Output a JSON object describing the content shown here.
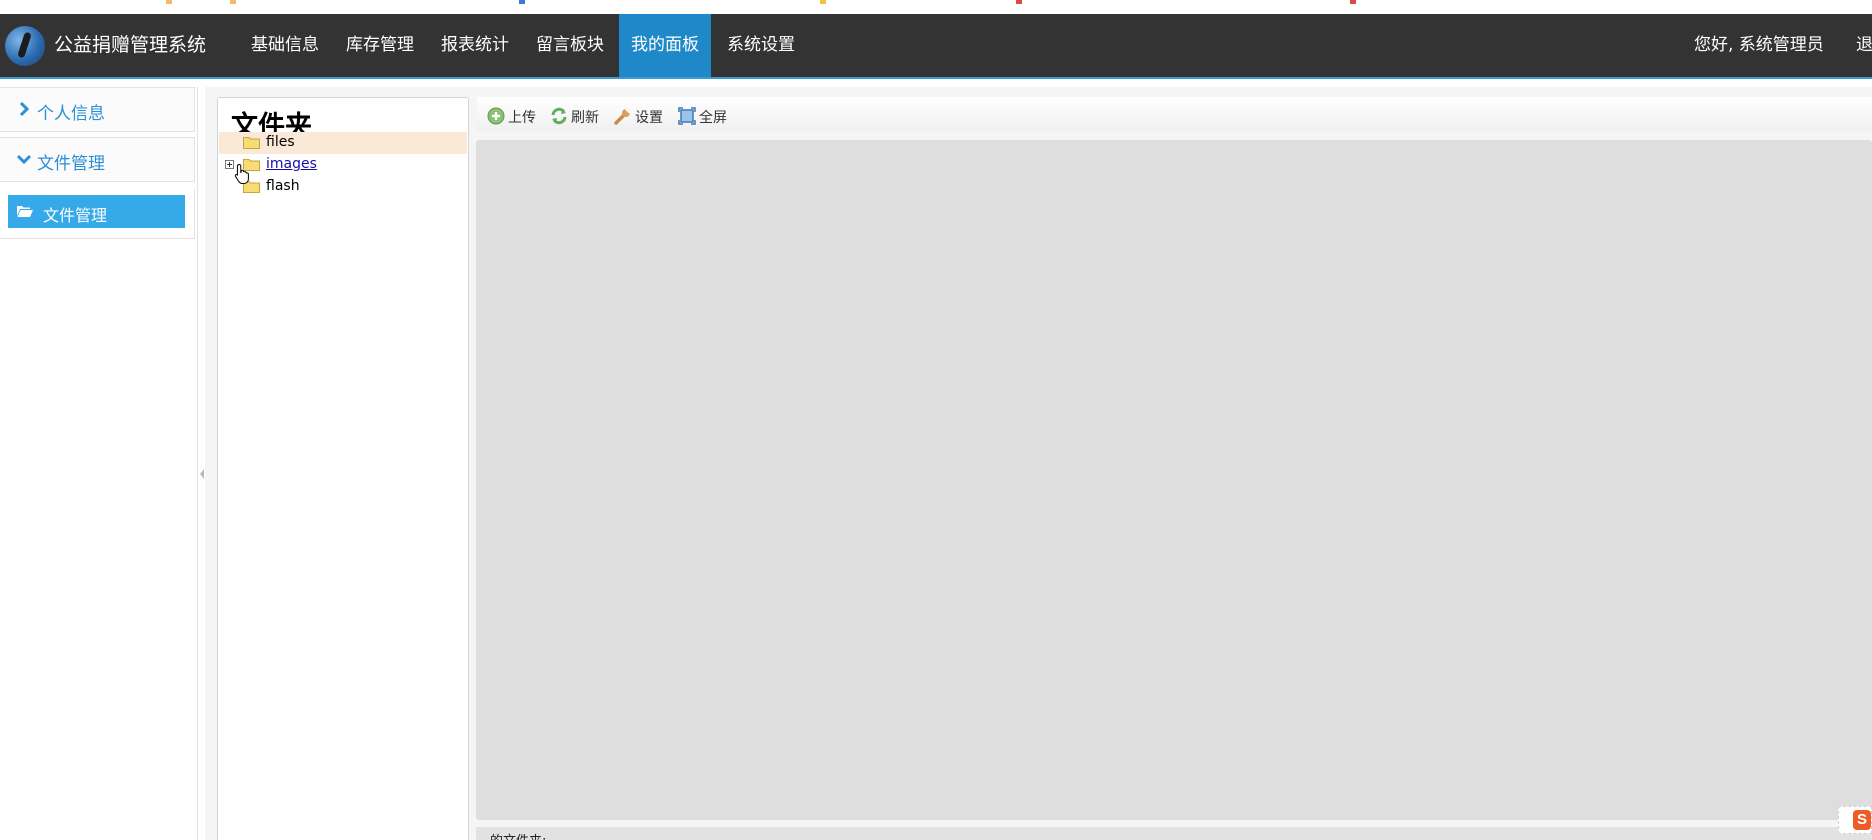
{
  "colors": {
    "navbar_bg": "#333333",
    "nav_active_bg": "#1e88c8",
    "accent": "#36a9e8",
    "sidebar_text": "#2b8fd6",
    "selected_row_bg": "#fbe9d8",
    "preview_bg": "#dedede"
  },
  "navbar": {
    "brand": "公益捐赠管理系统",
    "items": [
      {
        "label": "基础信息"
      },
      {
        "label": "库存管理"
      },
      {
        "label": "报表统计"
      },
      {
        "label": "留言板块"
      },
      {
        "label": "我的面板",
        "active": true
      },
      {
        "label": "系统设置"
      }
    ],
    "greeting": "您好, 系统管理员",
    "logout": "退出"
  },
  "sidebar": {
    "groups": [
      {
        "label": "个人信息",
        "icon": "chevron-right-icon",
        "expanded": false
      },
      {
        "label": "文件管理",
        "icon": "chevron-down-icon",
        "expanded": true
      }
    ],
    "active_item": {
      "label": "文件管理",
      "icon": "folder-open-icon"
    }
  },
  "file_manager": {
    "tree_title": "文件夹",
    "folders": [
      {
        "name": "files",
        "selected": true,
        "expandable": false
      },
      {
        "name": "images",
        "selected": false,
        "expandable": true,
        "hovered": true
      },
      {
        "name": "flash",
        "selected": false,
        "expandable": false
      }
    ],
    "toolbar": {
      "upload": "上传",
      "refresh": "刷新",
      "settings": "设置",
      "fullscreen": "全屏"
    },
    "status": "的文件夹:"
  },
  "sogou_badge": "S"
}
